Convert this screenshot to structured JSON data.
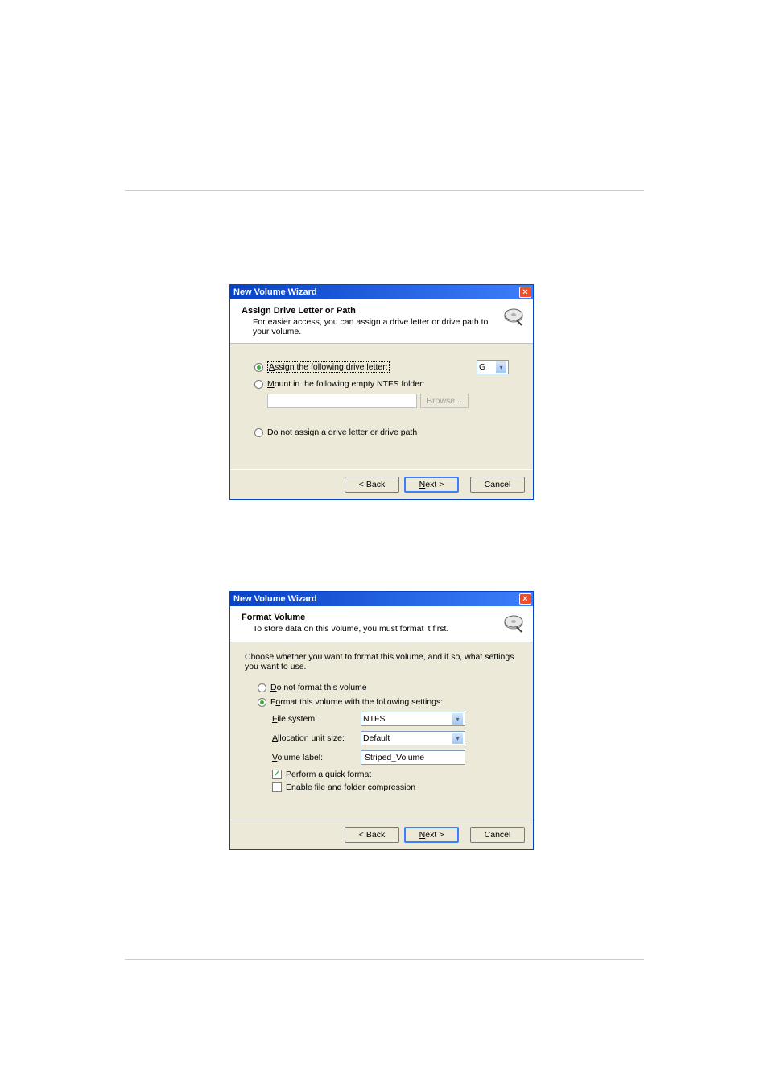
{
  "divider_present": true,
  "dialog1": {
    "title": "New Volume Wizard",
    "header_title": "Assign Drive Letter or Path",
    "header_subtitle": "For easier access, you can assign a drive letter or drive path to your volume.",
    "opt_assign_pre": "A",
    "opt_assign": "ssign the following drive letter:",
    "drive_letter": "G",
    "opt_mount_pre": "M",
    "opt_mount": "ount in the following empty NTFS folder:",
    "browse_label": "Browse...",
    "opt_none_pre": "D",
    "opt_none": "o not assign a drive letter or drive path",
    "back_label": "< Back",
    "next_label": "Next >",
    "cancel_label": "Cancel"
  },
  "dialog2": {
    "title": "New Volume Wizard",
    "header_title": "Format Volume",
    "header_subtitle": "To store data on this volume, you must format it first.",
    "intro": "Choose whether you want to format this volume, and if so, what settings you want to use.",
    "opt_noformat_pre": "D",
    "opt_noformat": "o not format this volume",
    "opt_format_pre": "F",
    "opt_format_mid": "o",
    "opt_format": "rmat this volume with the following settings:",
    "fs_label_pre": "F",
    "fs_label": "ile system:",
    "fs_value": "NTFS",
    "au_label_pre": "A",
    "au_label": "llocation unit size:",
    "au_value": "Default",
    "vl_label_pre": "V",
    "vl_label": "olume label:",
    "vl_value": "Striped_Volume",
    "quick_pre": "P",
    "quick_label": "erform a quick format",
    "compress_pre": "E",
    "compress_label": "nable file and folder compression",
    "back_label": "< Back",
    "next_label": "Next >",
    "cancel_label": "Cancel"
  }
}
